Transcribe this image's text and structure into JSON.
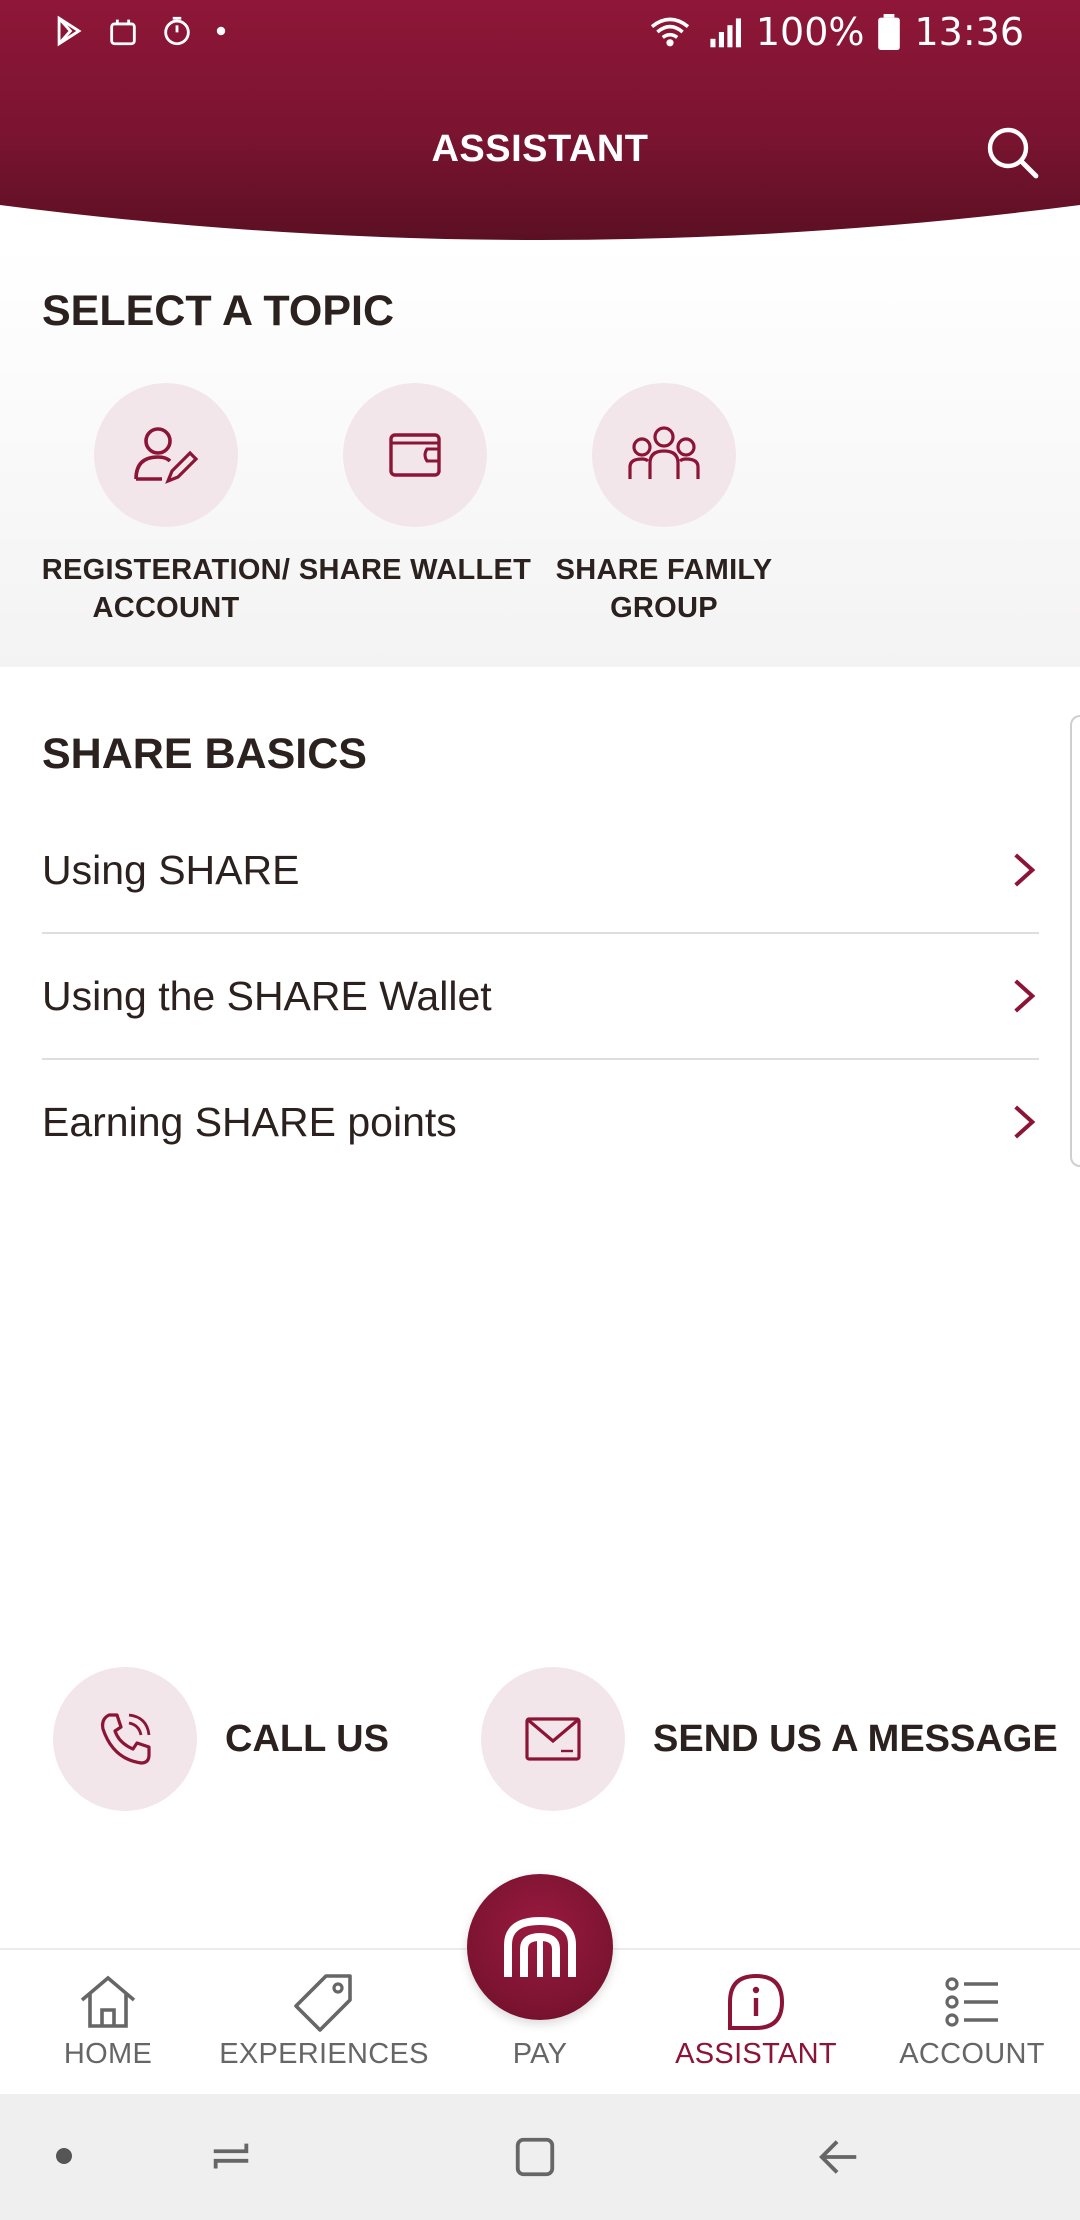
{
  "status_bar": {
    "battery": "100%",
    "time": "13:36"
  },
  "header": {
    "title": "ASSISTANT"
  },
  "topics": {
    "title": "SELECT A TOPIC",
    "items": [
      {
        "label": "REGISTERATION/ ACCOUNT",
        "icon": "user-edit-icon"
      },
      {
        "label": "SHARE WALLET",
        "icon": "wallet-icon"
      },
      {
        "label": "SHARE FAMILY GROUP",
        "icon": "family-group-icon"
      }
    ]
  },
  "basics": {
    "title": "SHARE BASICS",
    "items": [
      {
        "label": "Using SHARE"
      },
      {
        "label": "Using the SHARE Wallet"
      },
      {
        "label": "Earning SHARE points"
      }
    ]
  },
  "contact": {
    "call_label": "CALL US",
    "message_label": "SEND US A MESSAGE"
  },
  "bottom_nav": {
    "items": [
      {
        "label": "HOME",
        "icon": "home-icon"
      },
      {
        "label": "EXPERIENCES",
        "icon": "tag-icon"
      },
      {
        "label": "PAY",
        "icon": "share-logo-icon"
      },
      {
        "label": "ASSISTANT",
        "icon": "info-bubble-icon",
        "active": true
      },
      {
        "label": "ACCOUNT",
        "icon": "list-icon"
      }
    ]
  },
  "colors": {
    "brand": "#8c1537",
    "circle_bg": "#f3e6ea",
    "text": "#2b211e"
  }
}
